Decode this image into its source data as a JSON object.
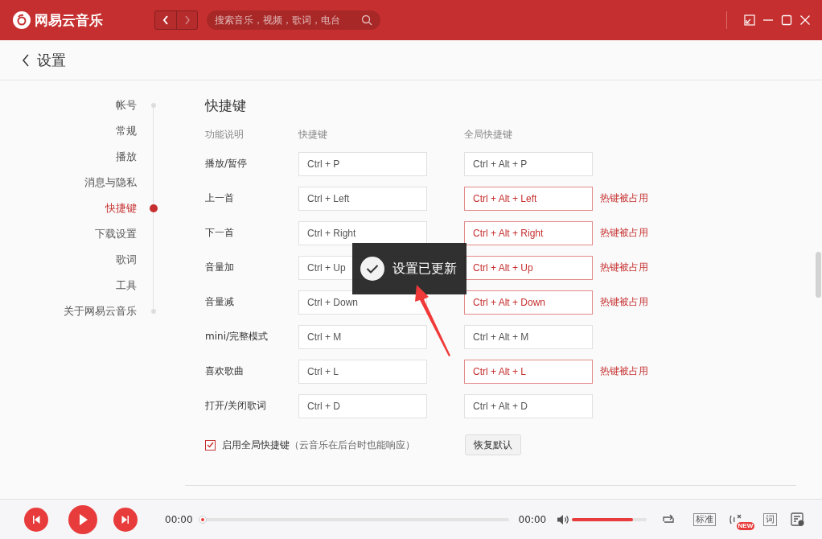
{
  "app": {
    "name": "网易云音乐"
  },
  "search": {
    "placeholder": "搜索音乐，视频，歌词，电台"
  },
  "page": {
    "title": "设置"
  },
  "sidebar": {
    "items": [
      {
        "label": "帐号",
        "selected": false
      },
      {
        "label": "常规",
        "selected": false
      },
      {
        "label": "播放",
        "selected": false
      },
      {
        "label": "消息与隐私",
        "selected": false
      },
      {
        "label": "快捷键",
        "selected": true
      },
      {
        "label": "下载设置",
        "selected": false
      },
      {
        "label": "歌词",
        "selected": false
      },
      {
        "label": "工具",
        "selected": false
      },
      {
        "label": "关于网易云音乐",
        "selected": false
      }
    ]
  },
  "section": {
    "title": "快捷键",
    "columns": [
      "功能说明",
      "快捷键",
      "全局快捷键"
    ],
    "rows": [
      {
        "function": "播放/暂停",
        "shortcut": "Ctrl + P",
        "global_shortcut": "Ctrl + Alt + P",
        "conflict": false
      },
      {
        "function": "上一首",
        "shortcut": "Ctrl + Left",
        "global_shortcut": "Ctrl + Alt + Left",
        "conflict": true,
        "warning": "热键被占用"
      },
      {
        "function": "下一首",
        "shortcut": "Ctrl + Right",
        "global_shortcut": "Ctrl + Alt + Right",
        "conflict": true,
        "warning": "热键被占用"
      },
      {
        "function": "音量加",
        "shortcut": "Ctrl + Up",
        "global_shortcut": "Ctrl + Alt + Up",
        "conflict": true,
        "warning": "热键被占用"
      },
      {
        "function": "音量减",
        "shortcut": "Ctrl + Down",
        "global_shortcut": "Ctrl + Alt + Down",
        "conflict": true,
        "warning": "热键被占用"
      },
      {
        "function": "mini/完整模式",
        "shortcut": "Ctrl + M",
        "global_shortcut": "Ctrl + Alt + M",
        "conflict": false
      },
      {
        "function": "喜欢歌曲",
        "shortcut": "Ctrl + L",
        "global_shortcut": "Ctrl + Alt + L",
        "conflict": true,
        "warning": "热键被占用"
      },
      {
        "function": "打开/关闭歌词",
        "shortcut": "Ctrl + D",
        "global_shortcut": "Ctrl + Alt + D",
        "conflict": false
      }
    ],
    "global_toggle": {
      "label": "启用全局快捷键",
      "note": "（云音乐在后台时也能响应）",
      "checked": true
    },
    "restore_button": "恢复默认"
  },
  "toast": {
    "message": "设置已更新"
  },
  "player": {
    "elapsed": "00:00",
    "total": "00:00",
    "progress": {
      "level": 0
    },
    "volume": {
      "level": 0.82
    },
    "quality": "标准",
    "badge": "NEW",
    "lyrics_button": "词"
  }
}
